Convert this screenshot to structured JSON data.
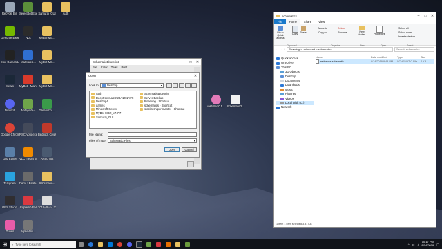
{
  "desktop": {
    "icons": [
      {
        "label": "Recycle Bin",
        "icon": "recycle-bin-icon",
        "color": "#9aa7b8"
      },
      {
        "label": "SelectBot.Exe",
        "icon": "app-icon",
        "color": "#5b8f3a"
      },
      {
        "label": "Samurai_GUI",
        "icon": "folder-icon",
        "color": "#e8c160"
      },
      {
        "label": "Auth",
        "icon": "folder-icon",
        "color": "#e8c160"
      },
      {
        "label": "GeForce Experience",
        "icon": "nvidia-icon",
        "color": "#76b900"
      },
      {
        "label": "Nox",
        "icon": "nox-icon",
        "color": "#2b2b2b"
      },
      {
        "label": "MyBot-MB...",
        "icon": "folder-icon",
        "color": "#e8c160"
      },
      {
        "label": "Epic Games Launcher",
        "icon": "epic-games-icon",
        "color": "#222222"
      },
      {
        "label": "Malwareb...",
        "icon": "malwarebytes-icon",
        "color": "#2f6fd1"
      },
      {
        "label": "MyBot-MB...",
        "icon": "folder-icon",
        "color": "#e8c160"
      },
      {
        "label": "Steam",
        "icon": "steam-icon",
        "color": "#1b2838"
      },
      {
        "label": "MyBot - Main The Storm...",
        "icon": "mybot-icon",
        "color": "#d93a2b"
      },
      {
        "label": "MyBot-MB...",
        "icon": "folder-icon",
        "color": "#e8c160"
      },
      {
        "label": "Discord",
        "icon": "discord-icon",
        "color": "#5865f2"
      },
      {
        "label": "Notepad++",
        "icon": "notepad-plus-icon",
        "color": "#6fa44a"
      },
      {
        "label": "Greenshot...",
        "icon": "greenshot-icon",
        "color": "#3a9a4a"
      },
      {
        "label": "Google Chrome",
        "icon": "chrome-icon",
        "color": "#db4437"
      },
      {
        "label": "RSCrypto.exe",
        "icon": "app-icon",
        "color": "#444a5a"
      },
      {
        "label": "Bedrock Crypto",
        "icon": "app-icon",
        "color": "#c0392b"
      },
      {
        "label": "Grid Editor",
        "icon": "app-icon",
        "color": "#5a7fa8"
      },
      {
        "label": "VLC media player",
        "icon": "vlc-icon",
        "color": "#f08a00"
      },
      {
        "label": "AHScripts",
        "icon": "script-icon",
        "color": "#4a5a70"
      },
      {
        "label": "Telegram",
        "icon": "telegram-icon",
        "color": "#2aa3df"
      },
      {
        "label": "Ram + Dashi...",
        "icon": "app-icon",
        "color": "#6a6a6a"
      },
      {
        "label": "Schematic...",
        "icon": "folder-icon",
        "color": "#e8c160"
      },
      {
        "label": "OBS Studio",
        "icon": "obs-icon",
        "color": "#302e31"
      },
      {
        "label": "ExpressVPN",
        "icon": "expressvpn-icon",
        "color": "#da3940"
      },
      {
        "label": "2019-08-14 22-14-02...",
        "icon": "video-icon",
        "color": "#dddddd"
      },
      {
        "label": "iTunes",
        "icon": "itunes-icon",
        "color": "#e85ca8"
      },
      {
        "label": "AlphaAnti...",
        "icon": "app-icon",
        "color": "#777777"
      },
      {
        "label": "installer-0.5...",
        "icon": "installer-icon",
        "color": "#e27ab8"
      },
      {
        "label": "Schematic2...",
        "icon": "document-icon",
        "color": "#f2f2f2"
      }
    ]
  },
  "bg_window": {
    "title": "SchematicBlueprint",
    "menu": [
      "File",
      "Color",
      "Tools",
      "Print"
    ]
  },
  "open_dialog": {
    "title": "Open",
    "look_in_label": "Look In:",
    "look_in_value": "Desktop",
    "files_left": [
      "Auth",
      "DeepFaceLabCUDA10.1AVX",
      "Desktop4",
      "games",
      "Minecraft Server",
      "MyBot-MBR_v7.7.7",
      "Samurai_GUI"
    ],
    "files_right": [
      "SchematicBlueprint",
      "Server Backup",
      "Roaming - Shortcut",
      "schematics - Shortcut",
      "stocks-sniper-master - Shortcut"
    ],
    "file_name_label": "File Name:",
    "file_name_value": "",
    "files_of_type_label": "Files of Type:",
    "files_of_type_value": "Schematic Files",
    "open_label": "Open",
    "cancel_label": "Cancel"
  },
  "explorer": {
    "title": "schematics",
    "ribbon_tabs": [
      "File",
      "Home",
      "Share",
      "View"
    ],
    "ribbon": {
      "pin": "Pin to Quick access",
      "copy": "Copy",
      "paste": "Paste",
      "move_to": "Move to",
      "copy_to": "Copy to",
      "delete": "Delete",
      "rename": "Rename",
      "new_folder": "New folder",
      "properties": "Properties",
      "select_all": "Select all",
      "select_none": "Select none",
      "invert": "Invert selection",
      "groups": [
        "Clipboard",
        "Organize",
        "New",
        "Open",
        "Select"
      ]
    },
    "path": "Roaming > .minecraft > schematics",
    "search_placeholder": "Search schematics",
    "nav": [
      "Quick access",
      "OneDrive",
      "This PC",
      "3D Objects",
      "Desktop",
      "Documents",
      "Downloads",
      "Music",
      "Pictures",
      "Videos",
      "Local Disk (C:)",
      "Network"
    ],
    "columns": [
      "Name",
      "Date modified",
      "Type",
      "Size"
    ],
    "files": [
      {
        "name": "redsense.schematic",
        "date": "8/14/2019 9:44 PM",
        "type": "SCHEMATIC File",
        "size": "4 KB"
      }
    ],
    "status": "1 item   1 item selected  3.31 KB"
  },
  "taskbar": {
    "search_placeholder": "Type here to search",
    "time": "10:17 PM",
    "date": "8/14/2019"
  }
}
